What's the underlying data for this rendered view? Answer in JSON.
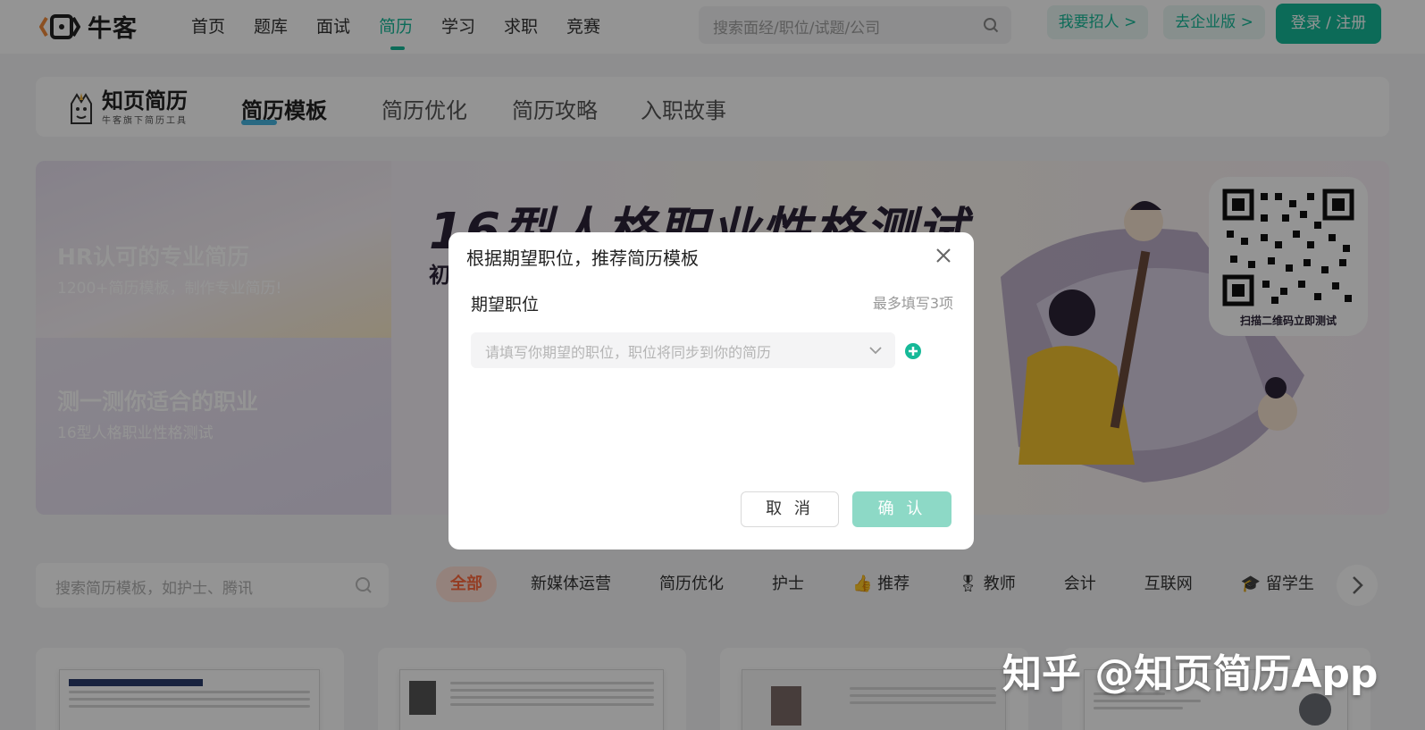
{
  "topnav": {
    "logo_text": "牛客",
    "links": [
      "首页",
      "题库",
      "面试",
      "简历",
      "学习",
      "求职",
      "竞赛"
    ],
    "active_index": 3,
    "search_placeholder": "搜索面经/职位/试题/公司",
    "hire_label": "我要招人 >",
    "enterprise_label": "去企业版 >",
    "login_label": "登录 / 注册"
  },
  "subheader": {
    "brand_title": "知页简历",
    "brand_subtitle": "牛客旗下简历工具",
    "tabs": [
      "简历模板",
      "简历优化",
      "简历攻略",
      "入职故事"
    ]
  },
  "banner": {
    "cards": [
      {
        "title": "HR认可的专业简历",
        "desc": "1200+简历模板，制作专业简历!"
      },
      {
        "title": "测一测你适合的职业",
        "desc": "16型人格职业性格测试"
      }
    ],
    "headline": "16型人格职业性格测试",
    "subline": "初",
    "qr_caption": "扫描二维码立即测试"
  },
  "filters": {
    "search_placeholder": "搜索简历模板，如护士、腾讯",
    "categories": [
      "全部",
      "新媒体运营",
      "简历优化",
      "护士",
      "推荐",
      "教师",
      "会计",
      "互联网",
      "留学生"
    ],
    "icons": [
      "",
      "",
      "",
      "",
      "👍",
      "🎖",
      "",
      "",
      "🎓"
    ]
  },
  "modal": {
    "title": "根据期望职位，推荐简历模板",
    "field_label": "期望职位",
    "field_hint": "最多填写3项",
    "field_placeholder": "请填写你期望的职位，职位将同步到你的简历",
    "cancel_label": "取 消",
    "confirm_label": "确 认"
  },
  "watermark": "知乎 @知页简历App",
  "colors": {
    "brand": "#16b998",
    "accent_orange": "#ff6a3d"
  }
}
